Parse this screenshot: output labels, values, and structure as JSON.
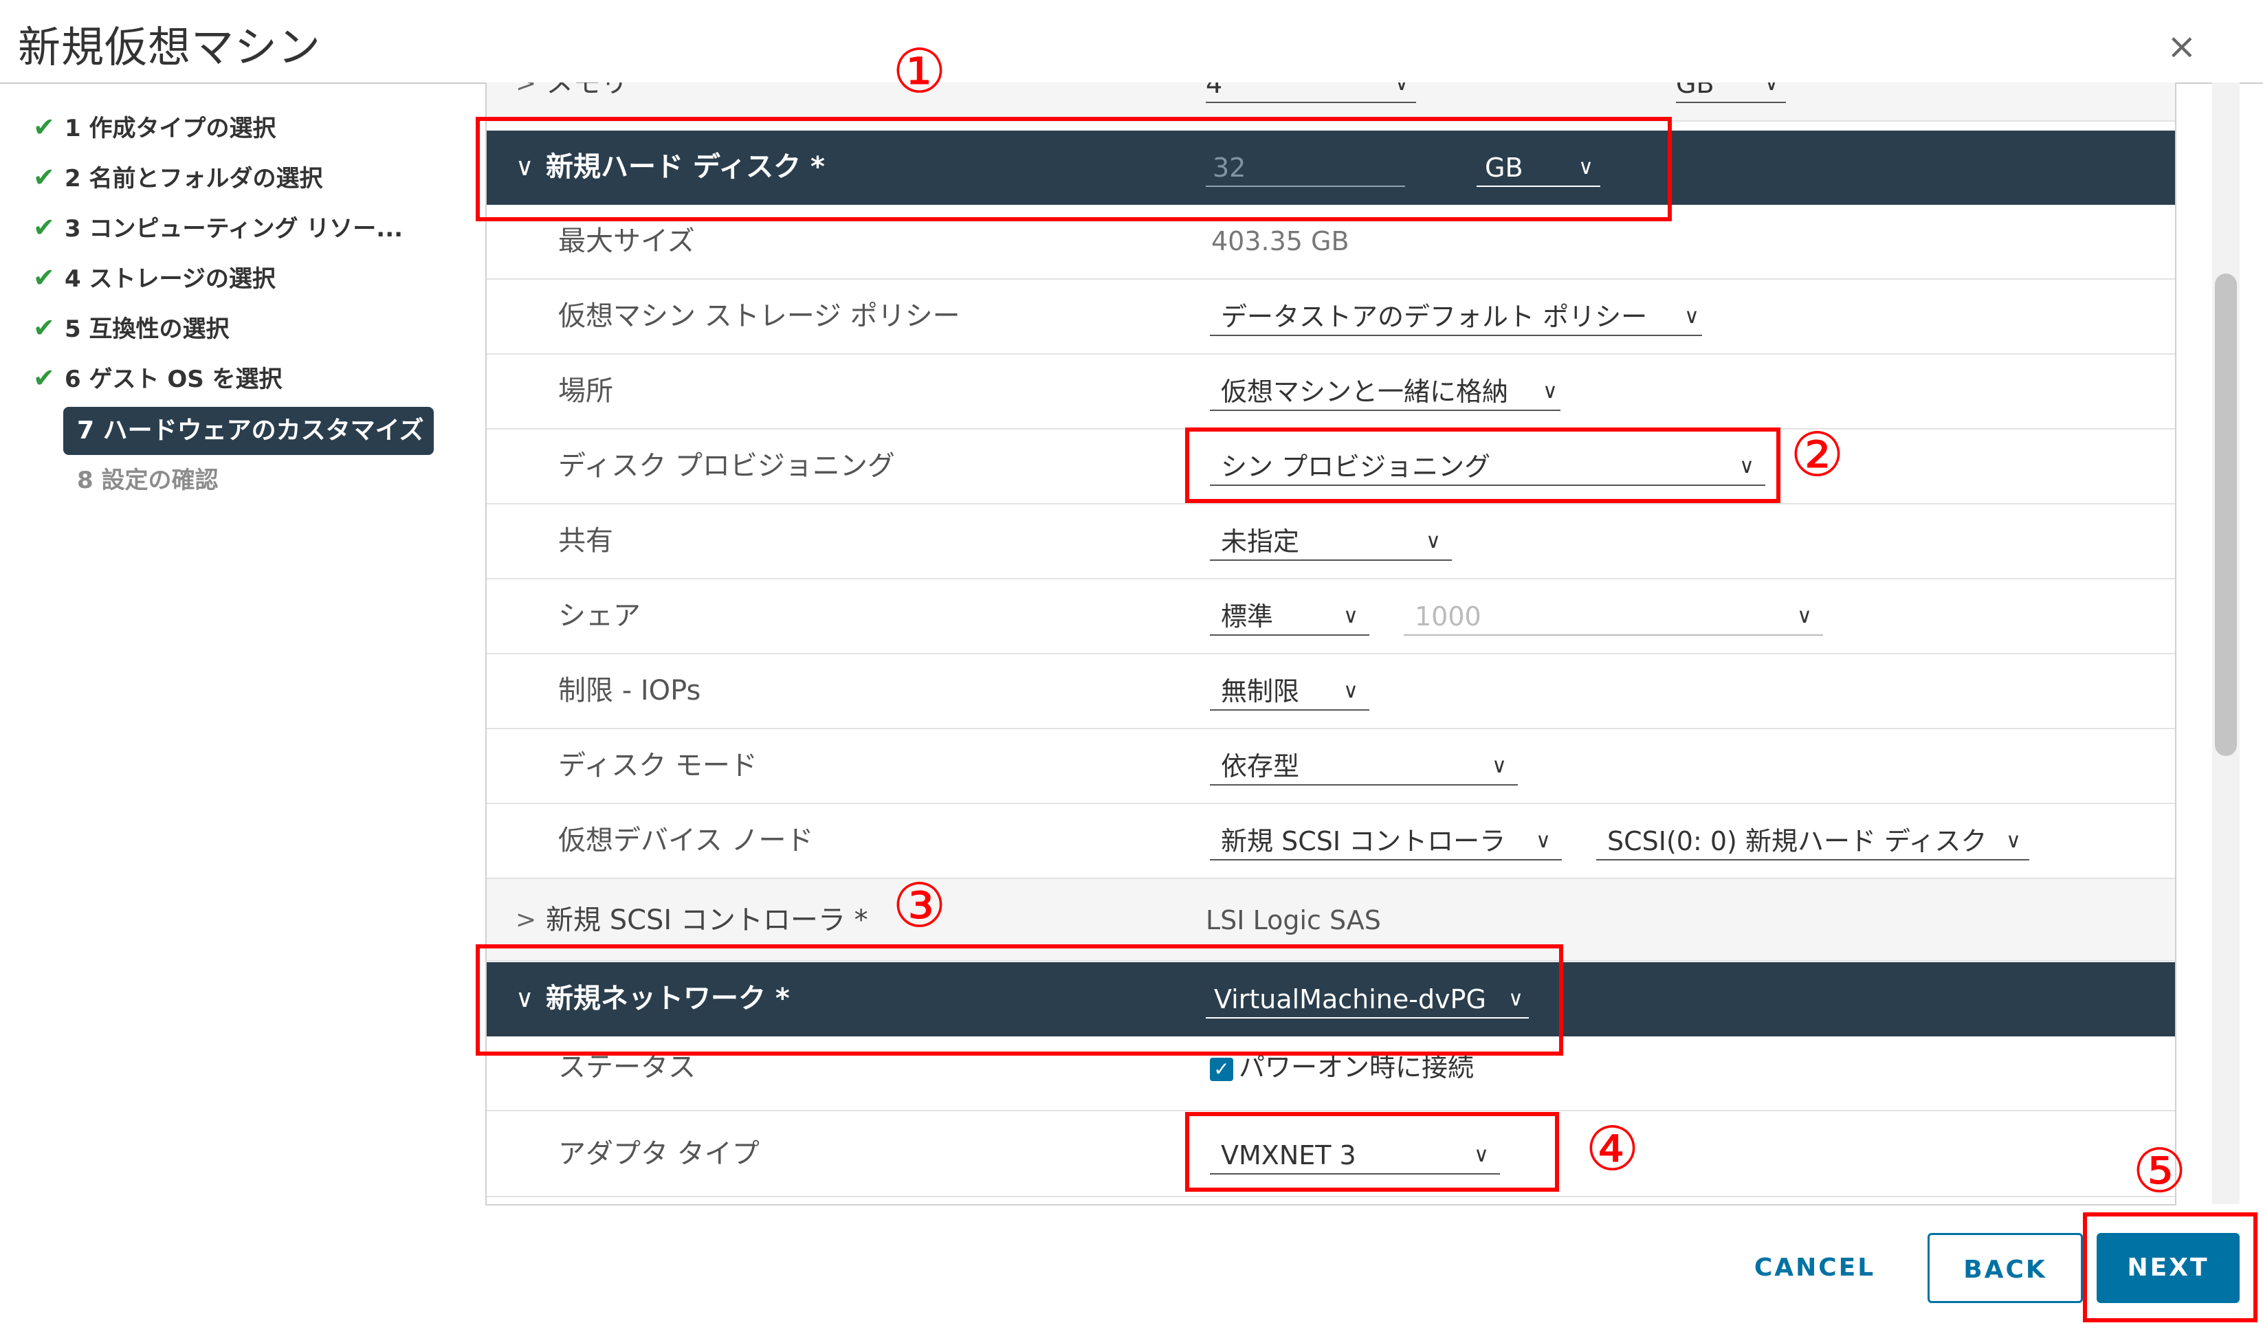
{
  "window": {
    "title": "新規仮想マシン",
    "close_glyph": "×"
  },
  "nav": {
    "check_glyph": "✔",
    "steps": [
      {
        "label": "1 作成タイプの選択"
      },
      {
        "label": "2 名前とフォルダの選択"
      },
      {
        "label": "3 コンピューティング リソー..."
      },
      {
        "label": "4 ストレージの選択"
      },
      {
        "label": "5 互換性の選択"
      },
      {
        "label": "6 ゲスト OS を選択"
      },
      {
        "label": "7 ハードウェアのカスタマイズ"
      },
      {
        "label": "8 設定の確認"
      }
    ]
  },
  "glyphs": {
    "collapsed": ">",
    "expanded": "∨",
    "chevron": "∨",
    "check": "✓"
  },
  "memory": {
    "label": "メモリ",
    "value": "4",
    "unit": "GB"
  },
  "hard_disk": {
    "label": "新規ハード ディスク *",
    "size": "32",
    "unit": "GB",
    "rows": [
      {
        "label": "最大サイズ",
        "value": "403.35 GB"
      },
      {
        "label": "仮想マシン ストレージ ポリシー",
        "value": "データストアのデフォルト ポリシー"
      },
      {
        "label": "場所",
        "value": "仮想マシンと一緒に格納"
      },
      {
        "label": "ディスク プロビジョニング",
        "value": "シン プロビジョニング"
      },
      {
        "label": "共有",
        "value": "未指定"
      },
      {
        "label": "シェア",
        "value": "標準",
        "value2": "1000"
      },
      {
        "label": "制限 - IOPs",
        "value": "無制限"
      },
      {
        "label": "ディスク モード",
        "value": "依存型"
      },
      {
        "label": "仮想デバイス ノード",
        "value": "新規 SCSI コントローラ",
        "value2": "SCSI(0: 0) 新規ハード ディスク"
      }
    ]
  },
  "scsi": {
    "label": "新規 SCSI コントローラ *",
    "value": "LSI Logic SAS"
  },
  "network": {
    "label": "新規ネットワーク *",
    "value": "VirtualMachine-dvPG",
    "status_label": "ステータス",
    "status_value": "パワーオン時に接続",
    "connected": true,
    "adapter_label": "アダプタ タイプ",
    "adapter_value": "VMXNET 3"
  },
  "annotations": [
    "①",
    "②",
    "③",
    "④",
    "⑤"
  ],
  "annotation_color": "#ff0000",
  "accent_color": "#0072a3",
  "footer": {
    "cancel": "CANCEL",
    "back": "BACK",
    "next": "NEXT"
  }
}
